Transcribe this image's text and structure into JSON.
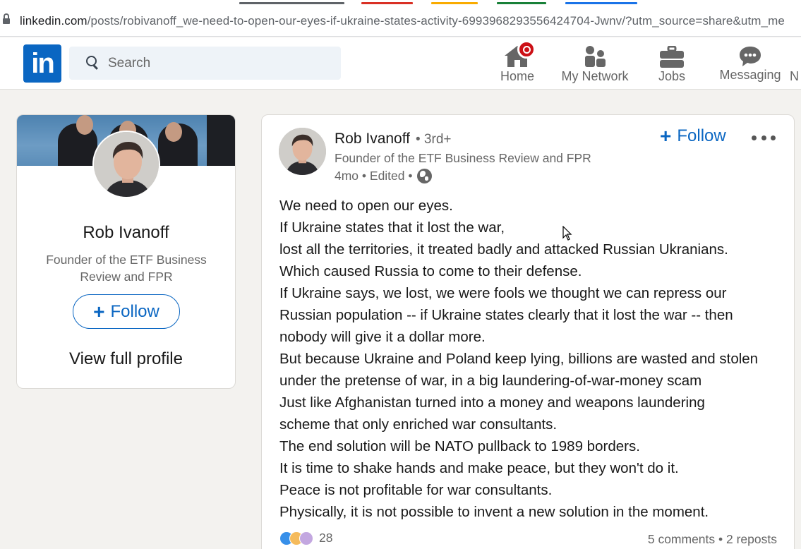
{
  "browser": {
    "url_host": "linkedin.com",
    "url_path": "/posts/robivanoff_we-need-to-open-our-eyes-if-ukraine-states-activity-6993968293556424704-Jwnv/?utm_source=share&utm_me"
  },
  "nav": {
    "logo_text": "in",
    "search_placeholder": "Search",
    "items": [
      {
        "label": "Home",
        "icon": "home-icon"
      },
      {
        "label": "My Network",
        "icon": "network-icon"
      },
      {
        "label": "Jobs",
        "icon": "briefcase-icon"
      },
      {
        "label": "Messaging",
        "icon": "messaging-icon"
      },
      {
        "label": "N",
        "icon": ""
      }
    ]
  },
  "profile_card": {
    "name": "Rob Ivanoff",
    "headline": "Founder of the ETF Business Review and FPR",
    "follow_label": "Follow",
    "view_profile_label": "View full profile"
  },
  "post": {
    "author_name": "Rob Ivanoff",
    "degree": "• 3rd+",
    "author_headline": "Founder of the ETF Business Review and FPR",
    "meta": "4mo • Edited •",
    "follow_label": "Follow",
    "body_lines": [
      "We need to open our eyes.",
      "If Ukraine states that it lost the war,",
      "lost all the territories, it treated badly and attacked Russian Ukranians.",
      "Which caused Russia to come to their defense.",
      "If Ukraine says, we lost, we were fools we thought we can repress our",
      "Russian population -- if Ukraine states clearly that it lost the war -- then",
      "nobody will give it a dollar more.",
      "But because Ukraine and Poland keep lying, billions are wasted and stolen",
      "under the pretense of war, in a big laundering-of-war-money scam",
      "Just like Afghanistan turned into a money and weapons laundering",
      "scheme that only enriched war consultants.",
      "The end solution will be NATO pullback to 1989 borders.",
      "It is time to shake hands and make peace, but they won't do it.",
      "Peace is not profitable for war consultants.",
      "Physically, it is not possible to invent a new solution in the moment."
    ],
    "reaction_count": "28",
    "stats": "5 comments • 2 reposts"
  },
  "colors": {
    "brand_blue": "#0a66c2",
    "page_bg": "#f3f2ef",
    "notification_red": "#cc1016"
  }
}
